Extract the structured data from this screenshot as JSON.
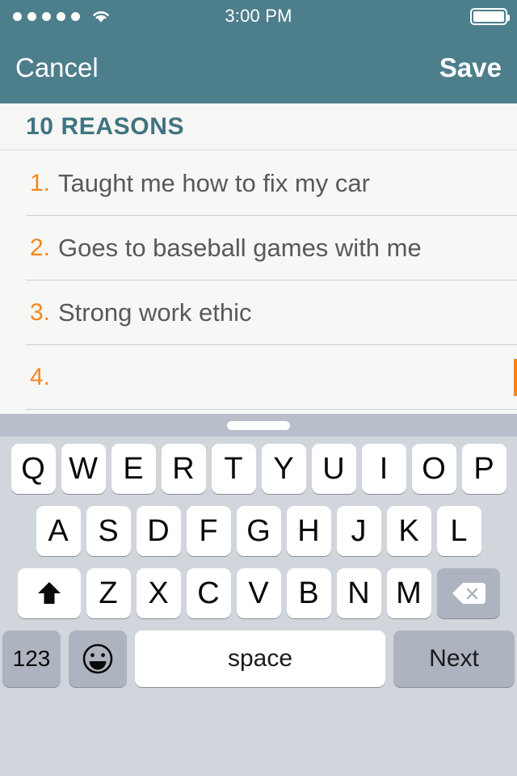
{
  "status_bar": {
    "signal_dots": 5,
    "wifi_icon": "wifi-icon",
    "time": "3:00 PM",
    "battery_icon": "battery-full-icon",
    "battery_level_percent": 100
  },
  "nav_bar": {
    "cancel_label": "Cancel",
    "save_label": "Save",
    "background_color": "#4d7e8c"
  },
  "list_header": {
    "title": "10 REASONS",
    "title_color": "#3f7480"
  },
  "reasons": [
    {
      "number": "1.",
      "text": "Taught me how to fix my car"
    },
    {
      "number": "2.",
      "text": "Goes to baseball games with me"
    },
    {
      "number": "3.",
      "text": "Strong work ethic"
    },
    {
      "number": "4.",
      "text": ""
    }
  ],
  "accent_colors": {
    "number_orange": "#f2881f",
    "caret_orange": "#f2881f",
    "body_text_gray": "#595959",
    "separator_gray": "#cfcfcd",
    "page_background": "#f7f7f5"
  },
  "keyboard": {
    "handle_icon": "keyboard-drag-handle",
    "row1": [
      "Q",
      "W",
      "E",
      "R",
      "T",
      "Y",
      "U",
      "I",
      "O",
      "P"
    ],
    "row2": [
      "A",
      "S",
      "D",
      "F",
      "G",
      "H",
      "J",
      "K",
      "L"
    ],
    "row3_letters": [
      "Z",
      "X",
      "C",
      "V",
      "B",
      "N",
      "M"
    ],
    "shift_key": {
      "icon": "shift-arrow-icon",
      "label": ""
    },
    "backspace_key": {
      "icon": "backspace-icon",
      "label": ""
    },
    "numbers_key_label": "123",
    "emoji_key": {
      "icon": "smiley-face-icon",
      "label": ""
    },
    "space_key_label": "space",
    "return_key_label": "Next",
    "background_color": "#d1d5dc",
    "key_color": "#ffffff",
    "modifier_key_color": "#adb3bf"
  }
}
